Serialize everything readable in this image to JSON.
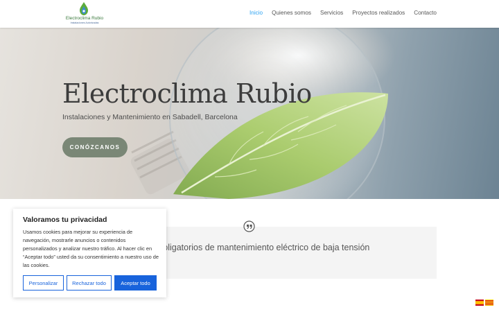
{
  "header": {
    "logo": {
      "name": "Electroclima Rubio",
      "tagline": "Instalaciones Autorizadas"
    },
    "nav": [
      {
        "label": "Inicio",
        "active": true
      },
      {
        "label": "Quienes somos",
        "active": false
      },
      {
        "label": "Servicios",
        "active": false
      },
      {
        "label": "Proyectos realizados",
        "active": false
      },
      {
        "label": "Contacto",
        "active": false
      }
    ]
  },
  "hero": {
    "title": "Electroclima Rubio",
    "subtitle": "Instalaciones y Mantenimiento en Sabadell, Barcelona",
    "button": "CONÓZCANOS"
  },
  "quote": {
    "icon": "quote-icon",
    "text": "ntratos obligatorios de mantenimiento eléctrico de baja tensión"
  },
  "cookie": {
    "title": "Valoramos tu privacidad",
    "body": "Usamos cookies para mejorar su experiencia de navegación, mostrarle anuncios o contenidos personalizados y analizar nuestro tráfico. Al hacer clic en “Aceptar todo” usted da su consentimiento a nuestro uso de las cookies.",
    "buttons": {
      "customize": "Personalizar",
      "reject": "Rechazar todo",
      "accept": "Aceptar todo"
    }
  },
  "language_flags": [
    "es-flag",
    "ca-flag"
  ],
  "colors": {
    "accent": "#2ea3f2",
    "hero_button": "#7a8776",
    "cookie_primary": "#1863dc",
    "quote_bg": "#f4f4f4"
  }
}
